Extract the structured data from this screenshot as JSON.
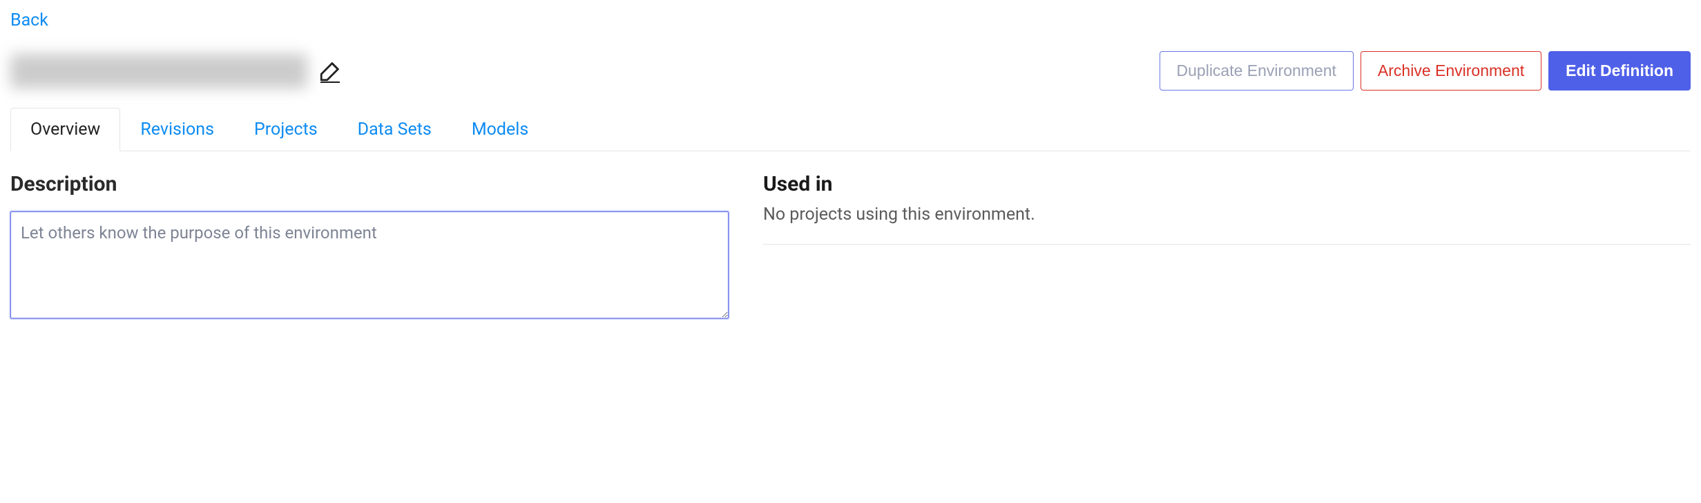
{
  "navigation": {
    "back_label": "Back"
  },
  "header": {
    "title_redacted": true,
    "actions": {
      "duplicate_label": "Duplicate Environment",
      "archive_label": "Archive Environment",
      "edit_label": "Edit Definition"
    }
  },
  "tabs": [
    {
      "label": "Overview",
      "active": true
    },
    {
      "label": "Revisions",
      "active": false
    },
    {
      "label": "Projects",
      "active": false
    },
    {
      "label": "Data Sets",
      "active": false
    },
    {
      "label": "Models",
      "active": false
    }
  ],
  "description": {
    "heading": "Description",
    "placeholder": "Let others know the purpose of this environment",
    "value": ""
  },
  "used_in": {
    "heading": "Used in",
    "empty_text": "No projects using this environment."
  }
}
